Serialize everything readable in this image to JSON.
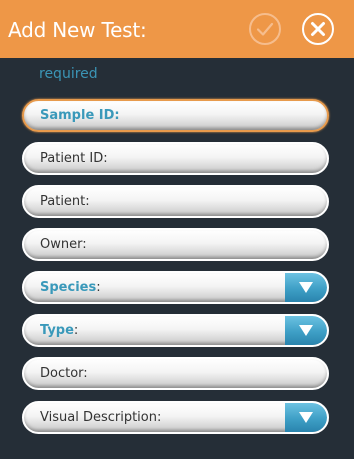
{
  "header": {
    "title": "Add New Test:",
    "confirm_icon": "checkmark-icon",
    "close_icon": "close-x-icon",
    "color": "#ee9747"
  },
  "required_label": "required",
  "fields": [
    {
      "label": "Sample ID:",
      "required": true,
      "dropdown": false,
      "active": true
    },
    {
      "label": "Patient ID:",
      "required": false,
      "dropdown": false
    },
    {
      "label": "Patient:",
      "required": false,
      "dropdown": false
    },
    {
      "label": "Owner:",
      "required": false,
      "dropdown": false
    },
    {
      "label": "Species",
      "suffix": ":",
      "required": true,
      "dropdown": true
    },
    {
      "label": "Type",
      "suffix": ":",
      "required": true,
      "dropdown": true
    },
    {
      "label": "Doctor:",
      "required": false,
      "dropdown": false
    },
    {
      "label": "Visual Description:",
      "required": false,
      "dropdown": true
    }
  ],
  "colors": {
    "accent_orange": "#ee9747",
    "required_blue": "#3a99ba",
    "dropdown_blue": "#3e9fc6",
    "background": "#252e37"
  }
}
